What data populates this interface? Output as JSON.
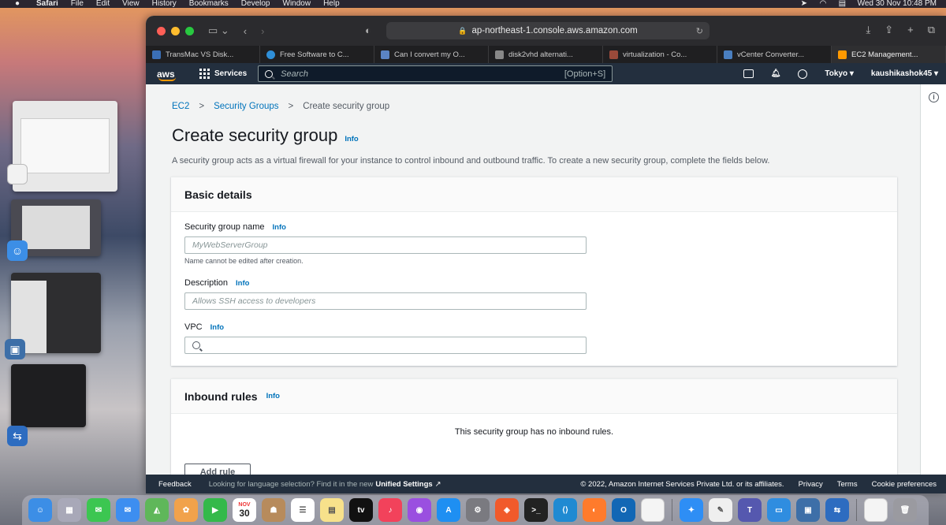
{
  "menubar": {
    "apple": "",
    "items": [
      "Safari",
      "File",
      "Edit",
      "View",
      "History",
      "Bookmarks",
      "Develop",
      "Window",
      "Help"
    ],
    "datetime": "Wed 30 Nov  10:48 PM"
  },
  "browser": {
    "url": "ap-northeast-1.console.aws.amazon.com",
    "tabs": [
      {
        "label": "TransMac VS Disk...",
        "color": "#3b6fb6"
      },
      {
        "label": "Free Software to C...",
        "color": "#2f8fd8"
      },
      {
        "label": "Can I convert my O...",
        "color": "#5b84c4"
      },
      {
        "label": "disk2vhd alternati...",
        "color": "#888888"
      },
      {
        "label": "virtualization - Co...",
        "color": "#9a4a3a"
      },
      {
        "label": "vCenter Converter...",
        "color": "#4a7fc0"
      },
      {
        "label": "EC2 Management...",
        "color": "#ff9900"
      }
    ]
  },
  "aws": {
    "logo": "aws",
    "services": "Services",
    "search_placeholder": "Search",
    "search_shortcut": "[Option+S]",
    "region": "Tokyo ▾",
    "account": "kaushikashok45 ▾"
  },
  "breadcrumb": {
    "ec2": "EC2",
    "security_groups": "Security Groups",
    "current": "Create security group",
    "sep": ">"
  },
  "page": {
    "title": "Create security group",
    "info": "Info",
    "description": "A security group acts as a virtual firewall for your instance to control inbound and outbound traffic. To create a new security group, complete the fields below."
  },
  "basic": {
    "heading": "Basic details",
    "name_label": "Security group name",
    "name_placeholder": "MyWebServerGroup",
    "name_hint": "Name cannot be edited after creation.",
    "desc_label": "Description",
    "desc_placeholder": "Allows SSH access to developers",
    "vpc_label": "VPC",
    "info": "Info"
  },
  "inbound": {
    "heading": "Inbound rules",
    "info": "Info",
    "empty": "This security group has no inbound rules.",
    "add_rule": "Add rule"
  },
  "footer": {
    "feedback": "Feedback",
    "language_text": "Looking for language selection? Find it in the new",
    "unified": "Unified Settings",
    "copyright": "© 2022, Amazon Internet Services Private Ltd. or its affiliates.",
    "privacy": "Privacy",
    "terms": "Terms",
    "cookies": "Cookie preferences"
  },
  "dock": {
    "calendar_month": "NOV",
    "calendar_day": "30",
    "tv": "tv"
  },
  "colors": {
    "aws_nav": "#232f3e",
    "aws_orange": "#ff9900",
    "link_blue": "#0073bb"
  }
}
